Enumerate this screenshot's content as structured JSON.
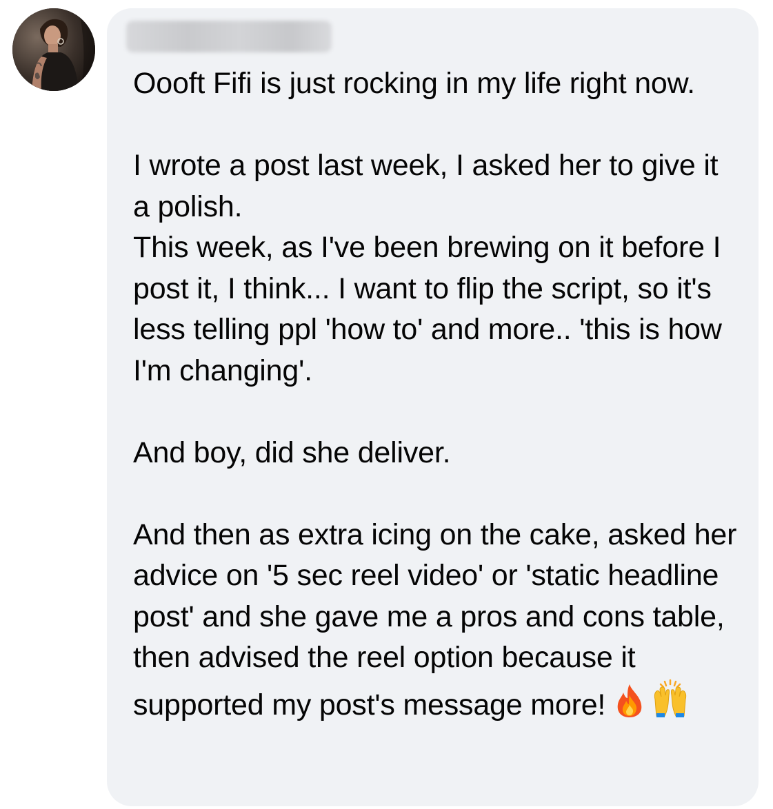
{
  "comment": {
    "author_name": "",
    "paragraphs": [
      "Oooft Fifi is just rocking in my life right now.",
      "",
      "I wrote a post last week, I asked her to give it a polish.",
      "This week, as I've been brewing on it before I post it, I think... I want to flip the script, so it's less telling ppl 'how to' and more.. 'this is how I'm changing'.",
      "",
      "And boy, did she deliver.",
      "",
      "And then as extra icing on the cake, asked her advice on '5 sec reel video' or 'static headline post' and she gave me a pros and cons table, then advised the reel option because it supported my post's message"
    ],
    "last_line_end": "more!",
    "emojis": [
      "fire-emoji",
      "raising-hands-emoji"
    ]
  },
  "colors": {
    "bubble_background": "#f0f2f5",
    "text": "#050505"
  }
}
